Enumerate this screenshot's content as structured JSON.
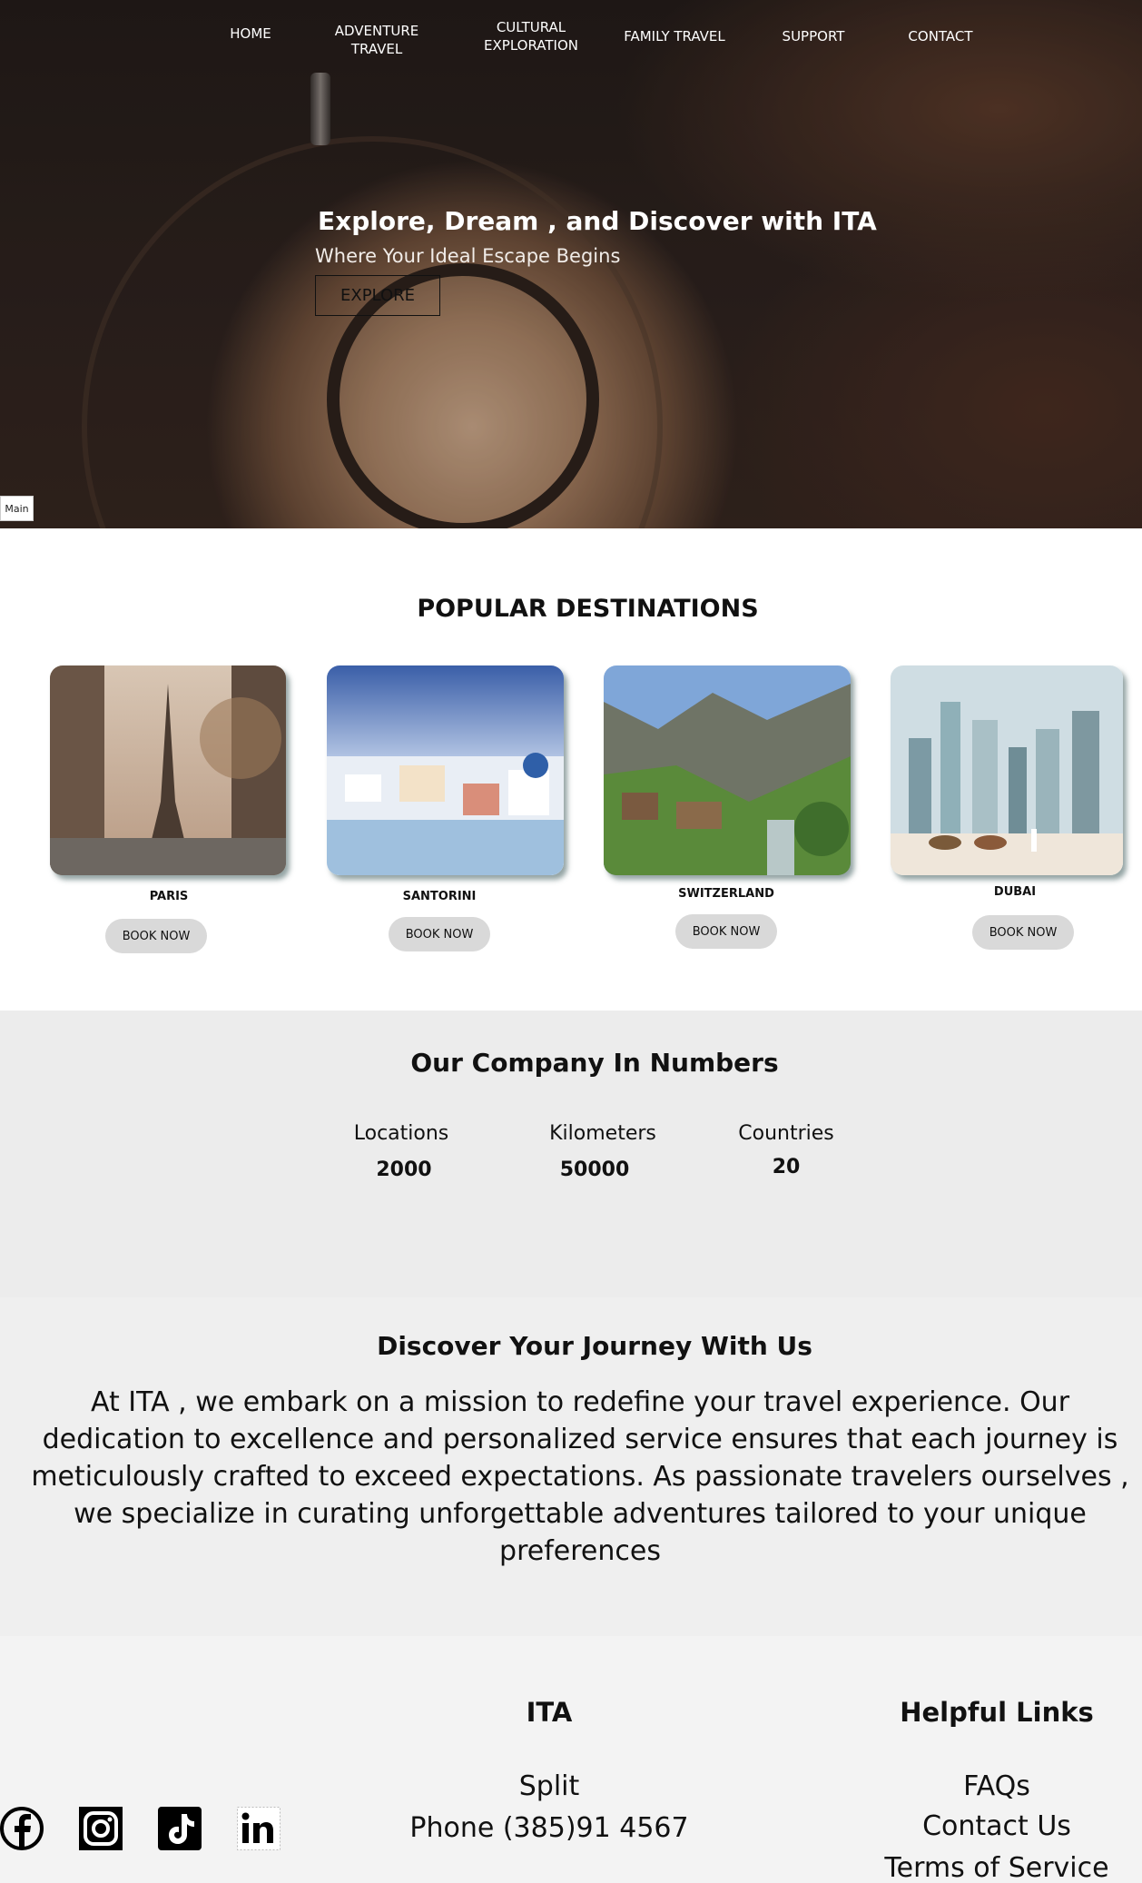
{
  "nav": {
    "home": "HOME",
    "adventure_1": "ADVENTURE",
    "adventure_2": "TRAVEL",
    "cultural_1": "CULTURAL",
    "cultural_2": "EXPLORATION",
    "family": "FAMILY TRAVEL",
    "support": "SUPPORT",
    "contact": "CONTACT"
  },
  "hero": {
    "title": "Explore, Dream , and Discover with ITA",
    "subtitle": "Where Your Ideal Escape Begins",
    "button": "EXPLORE",
    "main_tab": "Main"
  },
  "destinations": {
    "title": "POPULAR DESTINATIONS",
    "cards": [
      {
        "label": "PARIS",
        "button": "BOOK NOW"
      },
      {
        "label": "SANTORINI",
        "button": "BOOK NOW"
      },
      {
        "label": "SWITZERLAND",
        "button": "BOOK NOW"
      },
      {
        "label": "DUBAI",
        "button": "BOOK NOW"
      }
    ]
  },
  "numbers": {
    "title": "Our Company In Numbers",
    "stats": [
      {
        "label": "Locations",
        "value": "2000"
      },
      {
        "label": "Kilometers",
        "value": "50000"
      },
      {
        "label": "Countries",
        "value": "20"
      }
    ]
  },
  "journey": {
    "title": "Discover Your Journey With Us",
    "text": "At ITA , we embark on a mission to redefine your travel experience. Our dedication to excellence and personalized service ensures that each journey is meticulously crafted to exceed expectations. As passionate travelers ourselves , we specialize in curating unforgettable adventures tailored to your unique preferences"
  },
  "footer": {
    "ita_title": "ITA",
    "city": "Split",
    "phone": "Phone (385)91 4567",
    "links_title": "Helpful Links",
    "links": [
      "FAQs",
      "Contact Us",
      "Terms of Service"
    ],
    "social_icons": [
      "facebook-icon",
      "instagram-icon",
      "tiktok-icon",
      "linkedin-icon"
    ]
  }
}
